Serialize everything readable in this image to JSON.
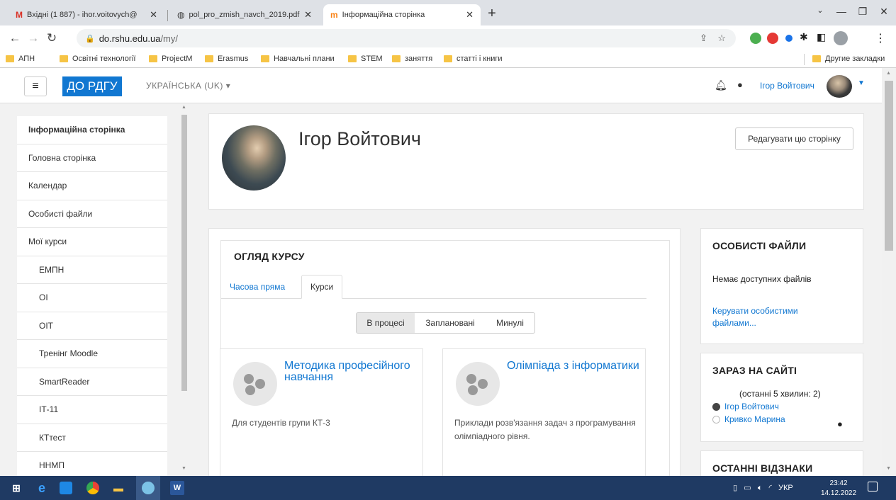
{
  "browser": {
    "tabs": [
      {
        "title": "Вхідні (1 887) - ihor.voitovych@",
        "icon": "gmail-icon"
      },
      {
        "title": "pol_pro_zmish_navch_2019.pdf",
        "icon": "globe-icon"
      },
      {
        "title": "Інформаційна сторінка",
        "icon": "moodle-icon",
        "active": true
      }
    ],
    "url_host": "do.rshu.edu.ua",
    "url_path": "/my/",
    "bookmarks": [
      "АПН",
      "Освітні технології",
      "ProjectM",
      "Erasmus",
      "Навчальні плани",
      "STEM",
      "заняття",
      "статті і книги"
    ],
    "other_bookmarks": "Другие закладки"
  },
  "navbar": {
    "brand": "ДО РДГУ",
    "language": "УКРАЇНСЬКА (UK)",
    "user_name": "Ігор Войтович"
  },
  "drawer": {
    "items": [
      {
        "label": "Інформаційна сторінка",
        "bold": true
      },
      {
        "label": "Головна сторінка"
      },
      {
        "label": "Календар"
      },
      {
        "label": "Особисті файли"
      },
      {
        "label": "Мої курси"
      },
      {
        "label": "ЕМПН",
        "sub": true
      },
      {
        "label": "ОІ",
        "sub": true
      },
      {
        "label": "ОІТ",
        "sub": true
      },
      {
        "label": "Тренінг Moodle",
        "sub": true
      },
      {
        "label": "SmartReader",
        "sub": true
      },
      {
        "label": "ІТ-11",
        "sub": true
      },
      {
        "label": "КТтест",
        "sub": true
      },
      {
        "label": "ННМП",
        "sub": true
      }
    ]
  },
  "profile": {
    "name": "Ігор Войтович",
    "edit_button": "Редагувати цю сторінку"
  },
  "overview": {
    "heading": "ОГЛЯД КУРСУ",
    "tabs": [
      "Часова пряма",
      "Курси"
    ],
    "filters": [
      "В процесі",
      "Заплановані",
      "Минулі"
    ],
    "courses": [
      {
        "title": "Методика професійного навчання",
        "desc": "Для студентів групи КТ-3"
      },
      {
        "title": "Олімпіада з інформатики",
        "desc": "Приклади розв'язання задач з програмування олімпіадного рівня."
      }
    ]
  },
  "blocks": {
    "files": {
      "heading": "ОСОБИСТІ ФАЙЛИ",
      "empty": "Немає доступних файлів",
      "manage": "Керувати особистими файлами..."
    },
    "online": {
      "heading": "ЗАРАЗ НА САЙТІ",
      "summary": "(останні 5 хвилин: 2)",
      "users": [
        "Ігор Войтович",
        "Кривко Марина"
      ]
    },
    "badges": {
      "heading": "ОСТАННІ ВІДЗНАКИ"
    }
  },
  "taskbar": {
    "lang": "УКР",
    "time": "23:42",
    "date": "14.12.2022"
  },
  "colors": {
    "accent": "#1177d1",
    "taskbar": "#1f3a63"
  }
}
